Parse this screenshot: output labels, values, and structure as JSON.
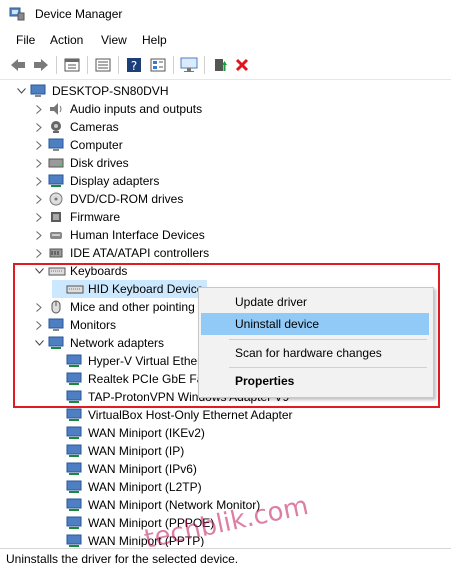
{
  "window": {
    "title": "Device Manager"
  },
  "menu": [
    "File",
    "Action",
    "View",
    "Help"
  ],
  "toolbar": {
    "buttons": [
      "back-arrow-icon",
      "forward-arrow-icon",
      "properties-icon",
      "list-view-icon",
      "help-icon",
      "details-icon",
      "scan-monitor-icon",
      "update-driver-icon",
      "uninstall-x-icon"
    ]
  },
  "tree": {
    "root": "DESKTOP-SN80DVH",
    "categories": [
      {
        "label": "Audio inputs and outputs"
      },
      {
        "label": "Cameras"
      },
      {
        "label": "Computer"
      },
      {
        "label": "Disk drives"
      },
      {
        "label": "Display adapters"
      },
      {
        "label": "DVD/CD-ROM drives"
      },
      {
        "label": "Firmware"
      },
      {
        "label": "Human Interface Devices"
      },
      {
        "label": "IDE ATA/ATAPI controllers"
      },
      {
        "label": "Keyboards"
      },
      {
        "label": "HID Keyboard Device"
      },
      {
        "label": "Mice and other pointing"
      },
      {
        "label": "Monitors"
      },
      {
        "label": "Network adapters"
      }
    ],
    "network_children": [
      "Hyper-V Virtual Ether",
      "Realtek PCIe GbE Fan",
      "TAP-ProtonVPN Windows Adapter V9",
      "VirtualBox Host-Only Ethernet Adapter",
      "WAN Miniport (IKEv2)",
      "WAN Miniport (IP)",
      "WAN Miniport (IPv6)",
      "WAN Miniport (L2TP)",
      "WAN Miniport (Network Monitor)",
      "WAN Miniport (PPPOE)",
      "WAN Miniport (PPTP)"
    ]
  },
  "context_menu": {
    "items": [
      "Update driver",
      "Uninstall device",
      "Scan for hardware changes",
      "Properties"
    ],
    "highlighted": "Uninstall device"
  },
  "status": {
    "text": "Uninstalls the driver for the selected device."
  },
  "watermark": "techblik.com",
  "colors": {
    "highlight_box": "#e01b24",
    "selection": "#cce8ff",
    "menu_highlight": "#91c9f7"
  }
}
